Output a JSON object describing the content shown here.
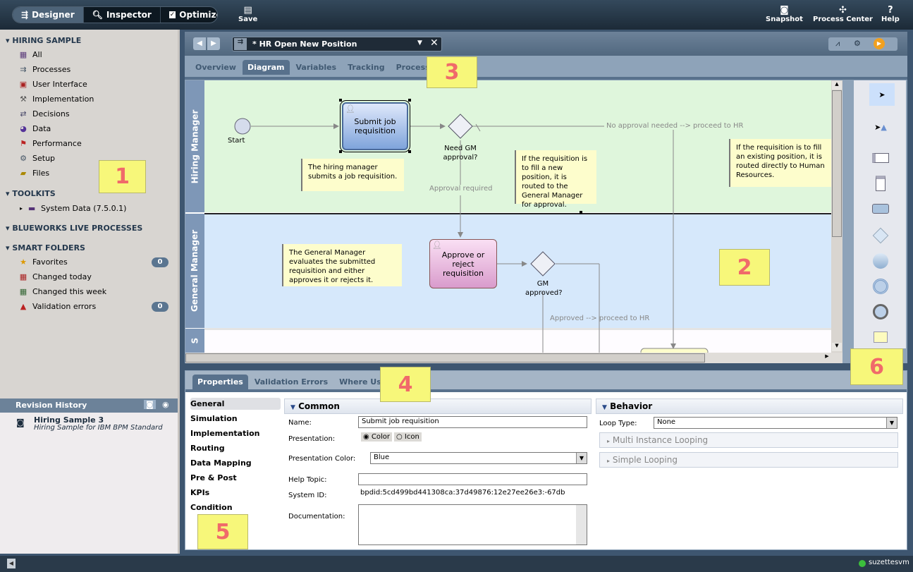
{
  "toolbar": {
    "modes": [
      "Designer",
      "Inspector",
      "Optimizer"
    ],
    "active_mode": "Designer",
    "save": "Save",
    "snapshot": "Snapshot",
    "process_center": "Process Center",
    "help": "Help"
  },
  "sidebar": {
    "hiring_sample": {
      "title": "HIRING SAMPLE",
      "items": [
        "All",
        "Processes",
        "User Interface",
        "Implementation",
        "Decisions",
        "Data",
        "Performance",
        "Setup",
        "Files"
      ]
    },
    "toolkits": {
      "title": "TOOLKITS",
      "items": [
        "System Data (7.5.0.1)"
      ]
    },
    "blueworks": {
      "title": "BLUEWORKS LIVE PROCESSES"
    },
    "smart_folders": {
      "title": "SMART FOLDERS",
      "items": [
        {
          "label": "Favorites",
          "count": "0"
        },
        {
          "label": "Changed today"
        },
        {
          "label": "Changed this week"
        },
        {
          "label": "Validation errors",
          "count": "0"
        }
      ]
    }
  },
  "revision_history": {
    "title": "Revision History",
    "entries": [
      {
        "name": "Hiring Sample 3",
        "description": "Hiring Sample for IBM BPM Standard"
      }
    ]
  },
  "editor": {
    "title": "* HR Open New Position",
    "tabs": [
      "Overview",
      "Diagram",
      "Variables",
      "Tracking",
      "Process KPIs"
    ],
    "active_tab": "Diagram"
  },
  "diagram": {
    "lanes": [
      "Hiring Manager",
      "General Manager",
      "S"
    ],
    "start": "Start",
    "task_submit": "Submit job requisition",
    "gateway_need": "Need GM approval?",
    "task_approve": "Approve or reject requisition",
    "gateway_approved": "GM approved?",
    "flows": {
      "no_approval": "No approval needed --> proceed to HR",
      "approval_required": "Approval required",
      "approved": "Approved --> proceed to HR"
    },
    "notes": [
      "The hiring manager submits a job requisition.",
      "If the requisition is to fill a new position, it is routed to the General Manager for approval.",
      "If the requisition is to fill an existing position, it is routed directly to Human Resources.",
      "The General Manager evaluates the submitted requisition and either approves it or rejects it."
    ]
  },
  "callouts": [
    "1",
    "2",
    "3",
    "4",
    "5",
    "6"
  ],
  "properties": {
    "tabs": [
      "Properties",
      "Validation Errors",
      "Where Used"
    ],
    "active_tab": "Properties",
    "nav": [
      "General",
      "Simulation",
      "Implementation",
      "Routing",
      "Data Mapping",
      "Pre & Post",
      "KPIs",
      "Condition"
    ],
    "common": {
      "title": "Common",
      "name_label": "Name:",
      "name_value": "Submit job requisition",
      "presentation_label": "Presentation:",
      "presentation_options": [
        "Color",
        "Icon"
      ],
      "presentation_selected": "Color",
      "color_label": "Presentation Color:",
      "color_value": "Blue",
      "help_label": "Help Topic:",
      "help_value": "",
      "sysid_label": "System ID:",
      "sysid_value": "bpdid:5cd499bd441308ca:37d49876:12e27ee26e3:-67db",
      "doc_label": "Documentation:",
      "doc_value": ""
    },
    "behavior": {
      "title": "Behavior",
      "loop_label": "Loop Type:",
      "loop_value": "None",
      "sections": [
        "Multi Instance Looping",
        "Simple Looping"
      ]
    }
  },
  "status": {
    "user": "suzettesvm",
    "online_color": "#3cbf3c"
  }
}
